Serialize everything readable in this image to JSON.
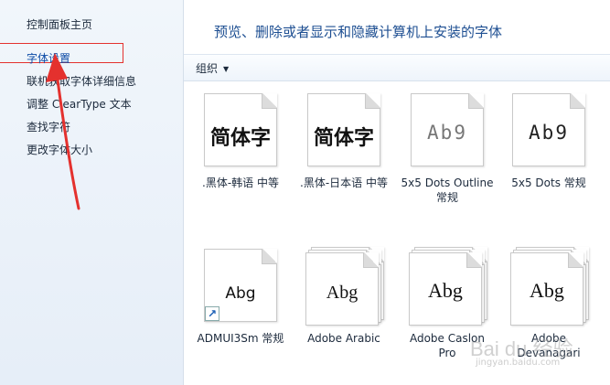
{
  "sidebar": {
    "home": "控制面板主页",
    "items": [
      {
        "label": "字体设置"
      },
      {
        "label": "联机获取字体详细信息"
      },
      {
        "label": "调整 ClearType 文本"
      },
      {
        "label": "查找字符"
      },
      {
        "label": "更改字体大小"
      }
    ]
  },
  "main": {
    "title": "预览、删除或者显示和隐藏计算机上安装的字体",
    "toolbar": {
      "organize": "组织"
    }
  },
  "fonts": [
    {
      "sample": "简体字",
      "name": ".黑体-韩语 中等"
    },
    {
      "sample": "简体字",
      "name": ".黑体-日本语 中等"
    },
    {
      "sample": "Ab9",
      "name": "5x5 Dots Outline 常规"
    },
    {
      "sample": "Ab9",
      "name": "5x5 Dots 常规"
    },
    {
      "sample": "Abg",
      "name": "ADMUI3Sm 常规"
    },
    {
      "sample": "Abg",
      "name": "Adobe Arabic"
    },
    {
      "sample": "Abg",
      "name": "Adobe Caslon Pro"
    },
    {
      "sample": "Abg",
      "name": "Adobe Devanagari"
    }
  ],
  "watermark": {
    "brand": "Bai du 经验",
    "url": "jingyan.baidu.com"
  },
  "colors": {
    "annotation_red": "#e4312e",
    "link_blue": "#1e4f92"
  }
}
